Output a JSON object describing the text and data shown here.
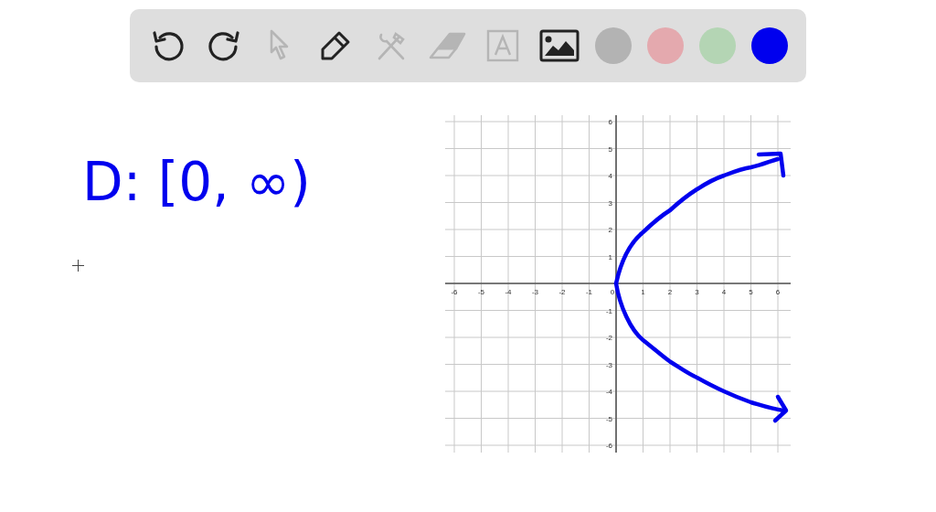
{
  "toolbar": {
    "tools": [
      {
        "kind": "undo",
        "disabled": false
      },
      {
        "kind": "redo",
        "disabled": false
      },
      {
        "kind": "select",
        "disabled": true
      },
      {
        "kind": "pen",
        "disabled": false
      },
      {
        "kind": "tools",
        "disabled": true
      },
      {
        "kind": "eraser",
        "disabled": true
      },
      {
        "kind": "text",
        "disabled": true
      },
      {
        "kind": "image",
        "disabled": false
      }
    ],
    "colors": [
      {
        "color": "#b3b3b3"
      },
      {
        "color": "#e4a9ae"
      },
      {
        "color": "#b4d5b4"
      },
      {
        "color": "#0000ee"
      }
    ]
  },
  "canvas": {
    "note": "D: [0, ∞)",
    "graph": {
      "x_ticks": [
        "-6",
        "-5",
        "-4",
        "-3",
        "-2",
        "-1",
        "0",
        "1",
        "2",
        "3",
        "4",
        "5",
        "6"
      ],
      "y_ticks": [
        "6",
        "5",
        "4",
        "3",
        "2",
        "1",
        "-1",
        "-2",
        "-3",
        "-4",
        "-5",
        "-6"
      ]
    }
  }
}
